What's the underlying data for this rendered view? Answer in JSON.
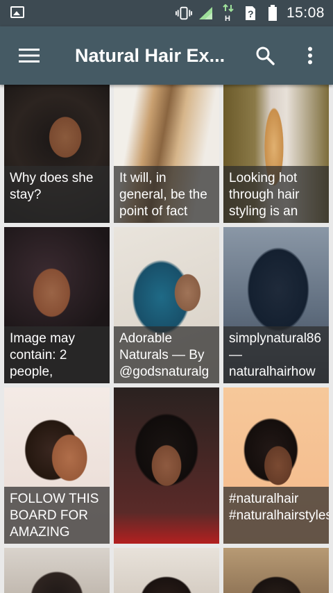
{
  "status_bar": {
    "time": "15:08"
  },
  "app_bar": {
    "title": "Natural Hair Ex..."
  },
  "tiles": [
    {
      "caption": "Why does she stay?"
    },
    {
      "caption": "It will, in general, be the point of fact"
    },
    {
      "caption": "Looking hot through hair styling is an"
    },
    {
      "caption": "Image may contain: 2 people,"
    },
    {
      "caption": "Adorable Naturals — By @godsnaturalg"
    },
    {
      "caption": "simplynatural86 — naturalhairhow"
    },
    {
      "caption": "FOLLOW THIS BOARD FOR AMAZING"
    },
    {
      "caption": ""
    },
    {
      "caption": "#naturalhair #naturalhairstyles"
    },
    {
      "caption": ""
    },
    {
      "caption": ""
    },
    {
      "caption": ""
    }
  ],
  "colors": {
    "app_bar": "#455a64",
    "status_bar": "#3d4a52",
    "caption_overlay": "rgba(45,45,45,0.72)"
  },
  "icons": [
    "gallery-icon",
    "vibrate-icon",
    "signal-icon",
    "data-arrows-icon",
    "sim-unknown-icon",
    "battery-icon",
    "menu-icon",
    "search-icon",
    "more-vert-icon"
  ]
}
